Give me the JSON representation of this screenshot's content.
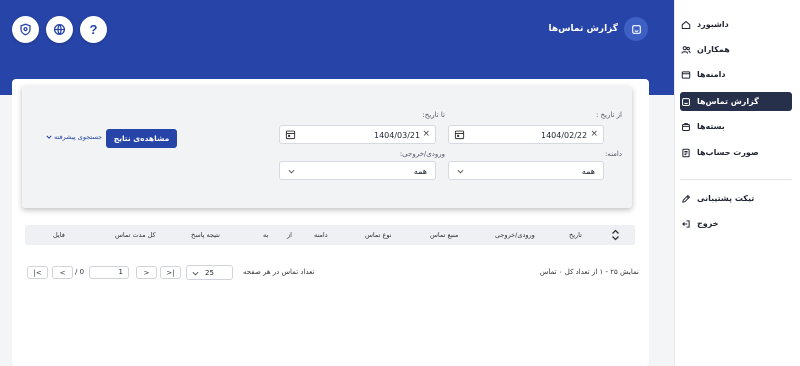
{
  "sidebar": {
    "items": [
      {
        "label": "داشبورد",
        "icon": "home-icon"
      },
      {
        "label": "همکاران",
        "icon": "users-icon"
      },
      {
        "label": "دامنه‌ها",
        "icon": "domain-icon"
      },
      {
        "label": "گزارش تماس‌ها",
        "icon": "call-report-icon",
        "active": true
      },
      {
        "label": "بسته‌ها",
        "icon": "package-icon"
      },
      {
        "label": "صورت حساب‌ها",
        "icon": "invoice-icon"
      },
      {
        "label": "تیکت پشتیبانی",
        "icon": "ticket-icon"
      },
      {
        "label": "خروج",
        "icon": "logout-icon"
      }
    ]
  },
  "header": {
    "title": "گزارش تماس‌ها",
    "help_glyph": "?",
    "accent": "#2745a8"
  },
  "filter": {
    "from_date_label": "از تاریخ :",
    "from_date_value": "1404/02/22",
    "to_date_label": "تا تاریخ:",
    "to_date_value": "1404/03/21",
    "domain_label": "دامنه:",
    "domain_value": "همه",
    "direction_label": "ورودی/خروجی:",
    "direction_value": "همه",
    "clear_glyph": "×",
    "view_button": "مشاهده‌ی نتایج",
    "advanced_search": "جستجوی پیشرفته"
  },
  "table": {
    "columns": [
      "تاریخ",
      "ورودی/خروجی",
      "منبع تماس",
      "نوع تماس",
      "دامنه",
      "از",
      "به",
      "نتیجه پاسخ",
      "کل مدت تماس",
      "فایل"
    ]
  },
  "pagination": {
    "summary": "نمایش ۲۵ - ۱ از تعداد کل ۰ تماس",
    "per_page_label": "تعداد تماس در هر صفحه",
    "per_page_value": "25",
    "current_page": "1",
    "total_pages": "/ 0"
  }
}
